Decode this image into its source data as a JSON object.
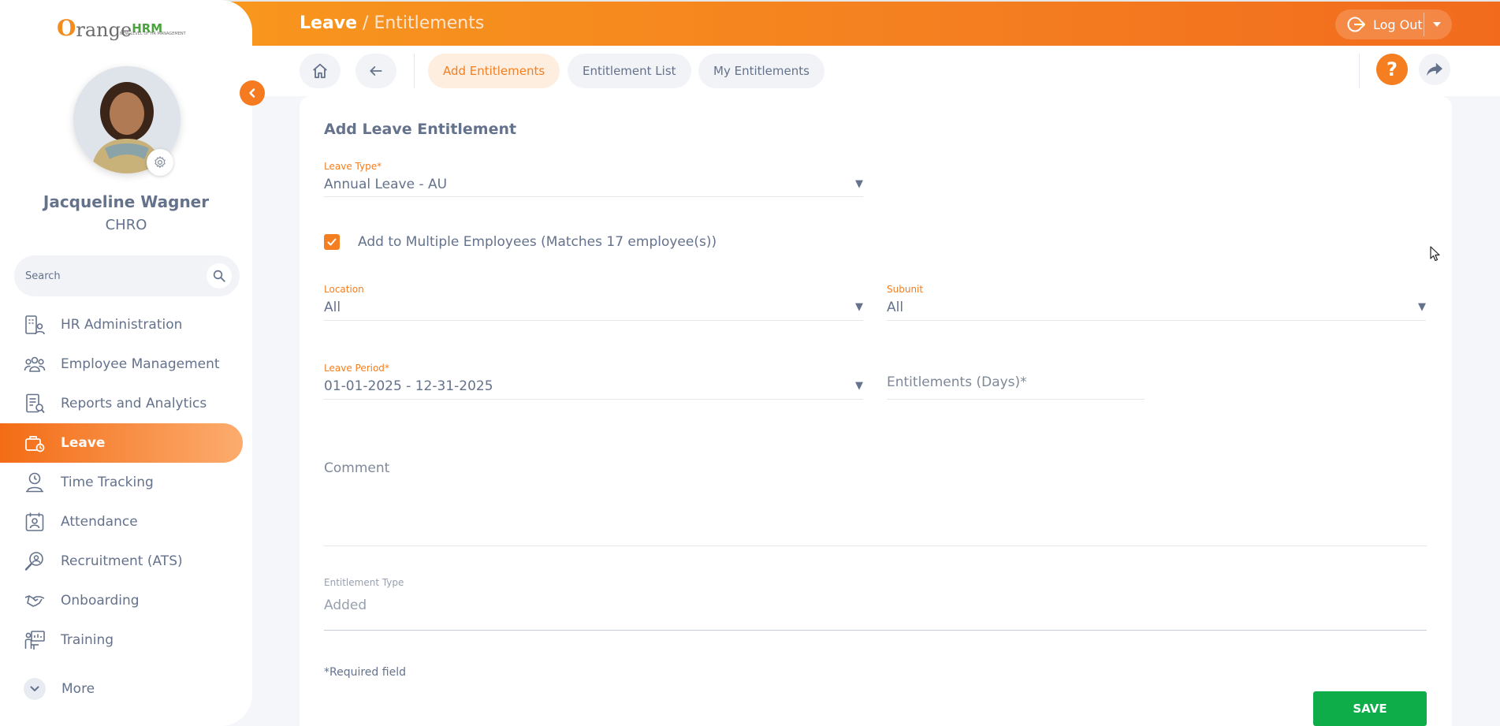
{
  "brand": {
    "logo_first": "O",
    "logo_rest": "range",
    "logo_hrm": "HRM",
    "tagline": "NEW LEVEL OF HR MANAGEMENT"
  },
  "user": {
    "name": "Jacqueline Wagner",
    "role": "CHRO"
  },
  "search": {
    "placeholder": "Search"
  },
  "nav": {
    "items": [
      {
        "label": "HR Administration",
        "icon": "hr-admin-icon"
      },
      {
        "label": "Employee Management",
        "icon": "employee-management-icon"
      },
      {
        "label": "Reports and Analytics",
        "icon": "reports-icon"
      },
      {
        "label": "Leave",
        "icon": "leave-icon",
        "active": true
      },
      {
        "label": "Time Tracking",
        "icon": "time-tracking-icon"
      },
      {
        "label": "Attendance",
        "icon": "attendance-icon"
      },
      {
        "label": "Recruitment (ATS)",
        "icon": "recruitment-icon"
      },
      {
        "label": "Onboarding",
        "icon": "onboarding-icon"
      },
      {
        "label": "Training",
        "icon": "training-icon"
      }
    ],
    "more_label": "More"
  },
  "header": {
    "module": "Leave",
    "separator": " / ",
    "page": "Entitlements",
    "logout_label": "Log Out"
  },
  "toolbar": {
    "tabs": [
      {
        "label": "Add Entitlements",
        "active": true
      },
      {
        "label": "Entitlement List"
      },
      {
        "label": "My Entitlements"
      }
    ],
    "help_label": "?"
  },
  "form": {
    "title": "Add Leave Entitlement",
    "leave_type": {
      "label": "Leave Type",
      "required_mark": "*",
      "value": "Annual Leave - AU"
    },
    "multiple_employees": {
      "checked": true,
      "label": "Add to Multiple Employees (Matches 17 employee(s))"
    },
    "location": {
      "label": "Location",
      "value": "All"
    },
    "subunit": {
      "label": "Subunit",
      "value": "All"
    },
    "leave_period": {
      "label": "Leave Period",
      "required_mark": "*",
      "value": "01-01-2025 - 12-31-2025"
    },
    "entitlements": {
      "label": "Entitlements (Days)",
      "required_mark": "*"
    },
    "comment": {
      "label": "Comment"
    },
    "entitlement_type": {
      "label": "Entitlement Type",
      "value": "Added"
    },
    "required_note": "*Required field",
    "save_label": "SAVE"
  },
  "colors": {
    "accent": "#f47e20",
    "save": "#0ead4a",
    "text": "#64728c"
  }
}
